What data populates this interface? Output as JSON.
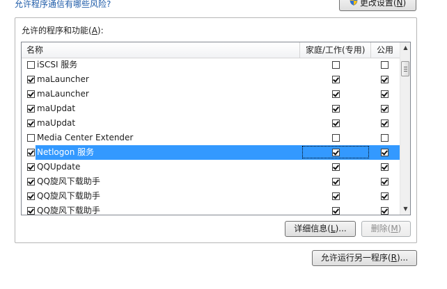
{
  "top": {
    "risk_link": "允许程序通信有哪些风险?",
    "change_settings": "更改设置(N)"
  },
  "group": {
    "label": "允许的程序和功能(A):"
  },
  "columns": {
    "name": "名称",
    "home": "家庭/工作(专用)",
    "public": "公用"
  },
  "rows": [
    {
      "name": "iSCSI 服务",
      "enabled": false,
      "home": false,
      "public": false,
      "selected": false
    },
    {
      "name": "maLauncher",
      "enabled": true,
      "home": true,
      "public": true,
      "selected": false
    },
    {
      "name": "maLauncher",
      "enabled": true,
      "home": true,
      "public": true,
      "selected": false
    },
    {
      "name": "maUpdat",
      "enabled": true,
      "home": true,
      "public": true,
      "selected": false
    },
    {
      "name": "maUpdat",
      "enabled": true,
      "home": true,
      "public": true,
      "selected": false
    },
    {
      "name": "Media Center Extender",
      "enabled": false,
      "home": false,
      "public": false,
      "selected": false
    },
    {
      "name": "Netlogon 服务",
      "enabled": true,
      "home": true,
      "public": true,
      "selected": true
    },
    {
      "name": "QQUpdate",
      "enabled": true,
      "home": true,
      "public": true,
      "selected": false
    },
    {
      "name": "QQ旋风下载助手",
      "enabled": true,
      "home": true,
      "public": true,
      "selected": false
    },
    {
      "name": "QQ旋风下载助手",
      "enabled": true,
      "home": true,
      "public": true,
      "selected": false
    },
    {
      "name": "QQ旋风下载助手",
      "enabled": true,
      "home": true,
      "public": true,
      "selected": false
    }
  ],
  "buttons": {
    "details": "详细信息(L)...",
    "remove": "删除(M)",
    "allow_another": "允许运行另一程序(R)..."
  },
  "colors": {
    "selection": "#3399ff",
    "link": "#1e5ba8"
  }
}
